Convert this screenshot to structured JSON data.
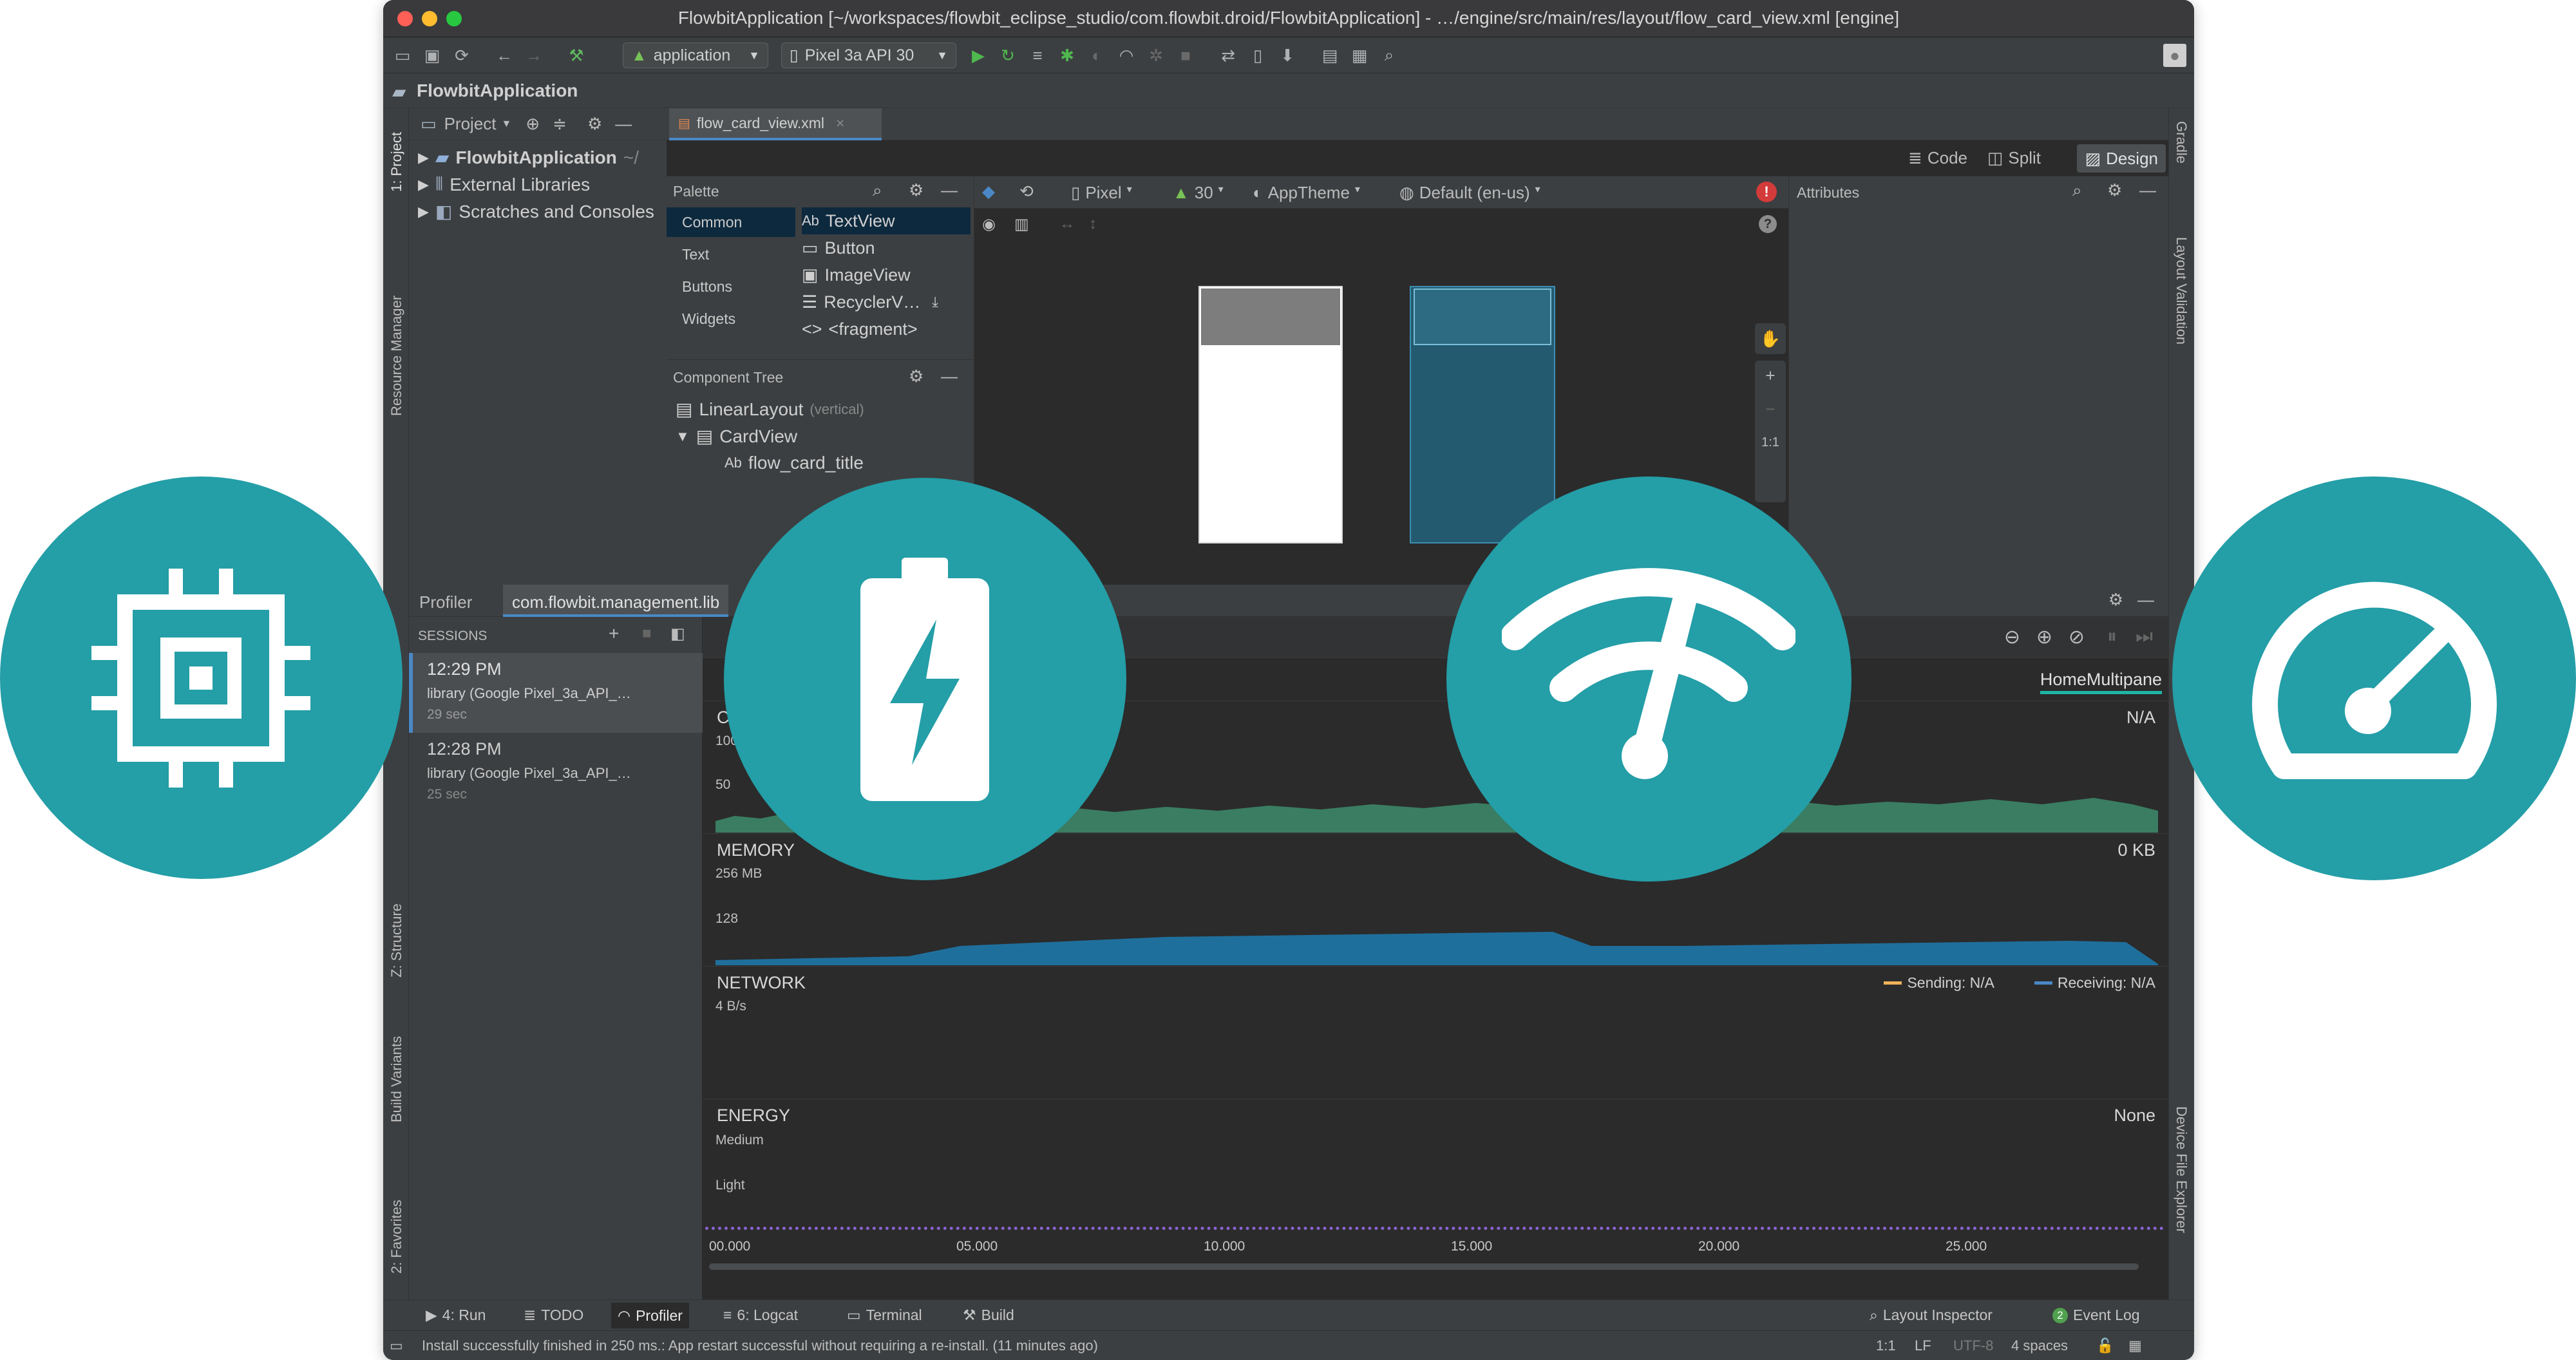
{
  "window": {
    "title": "FlowbitApplication [~/workspaces/flowbit_eclipse_studio/com.flowbit.droid/FlowbitApplication] - …/engine/src/main/res/layout/flow_card_view.xml [engine]"
  },
  "toolbar": {
    "run_config": "application",
    "device": "Pixel 3a API 30"
  },
  "navbar": {
    "project_name": "FlowbitApplication"
  },
  "left_strip": {
    "project_tab": "1: Project",
    "resource_manager": "Resource Manager",
    "structure": "Z: Structure",
    "build_variants": "Build Variants",
    "favorites": "2: Favorites"
  },
  "right_strip": {
    "gradle": "Gradle",
    "layout_validation": "Layout Validation",
    "device_file_explorer": "Device File Explorer"
  },
  "project_panel": {
    "view_label": "Project",
    "items": [
      {
        "label": "FlowbitApplication",
        "suffix": "~/"
      },
      {
        "label": "External Libraries"
      },
      {
        "label": "Scratches and Consoles"
      }
    ]
  },
  "editor": {
    "tab": "flow_card_view.xml",
    "mode_code": "Code",
    "mode_split": "Split",
    "mode_design": "Design"
  },
  "palette": {
    "title": "Palette",
    "categories": [
      "Common",
      "Text",
      "Buttons",
      "Widgets"
    ],
    "items": [
      {
        "icon": "Ab",
        "label": "TextView"
      },
      {
        "icon": "▭",
        "label": "Button"
      },
      {
        "icon": "▣",
        "label": "ImageView"
      },
      {
        "icon": "☰",
        "label": "RecyclerV…"
      },
      {
        "icon": "<>",
        "label": "<fragment>"
      }
    ]
  },
  "component_tree": {
    "title": "Component Tree",
    "rows": [
      {
        "label": "LinearLayout",
        "note": "(vertical)"
      },
      {
        "label": "CardView"
      },
      {
        "label": "flow_card_title"
      }
    ]
  },
  "design_toolbar": {
    "device": "Pixel",
    "api": "30",
    "theme": "AppTheme",
    "locale": "Default (en-us)",
    "zoom_fit": "1:1"
  },
  "attributes": {
    "title": "Attributes"
  },
  "profiler": {
    "tab_profiler": "Profiler",
    "tab_process": "com.flowbit.management.lib",
    "sessions_label": "SESSIONS",
    "sessions": [
      {
        "time": "12:29 PM",
        "name": "library (Google Pixel_3a_API_…",
        "duration": "29 sec"
      },
      {
        "time": "12:28 PM",
        "name": "library (Google Pixel_3a_API_…",
        "duration": "25 sec"
      }
    ],
    "activity_label": "HomeMultipane",
    "cpu": {
      "label": "CPU",
      "value": "N/A",
      "tick_top": "100 %",
      "tick_mid": "50"
    },
    "memory": {
      "label": "MEMORY",
      "value": "0 KB",
      "tick_top": "256 MB",
      "tick_mid": "128"
    },
    "network": {
      "label": "NETWORK",
      "tick_top": "4 B/s",
      "sending": "Sending: N/A",
      "receiving": "Receiving: N/A"
    },
    "energy": {
      "label": "ENERGY",
      "value": "None",
      "tick_top": "Medium",
      "tick_mid": "Light"
    },
    "timeline": [
      "00.000",
      "05.000",
      "10.000",
      "15.000",
      "20.000",
      "25.000"
    ]
  },
  "bottom_tabs": {
    "run": "4: Run",
    "todo": "TODO",
    "profiler": "Profiler",
    "logcat": "6: Logcat",
    "terminal": "Terminal",
    "build": "Build",
    "layout_inspector": "Layout Inspector",
    "event_log": "Event Log",
    "event_count": "2"
  },
  "status": {
    "message": "Install successfully finished in 250 ms.: App restart successful without requiring a re-install. (11 minutes ago)",
    "position": "1:1",
    "line_sep": "LF",
    "encoding": "UTF-8",
    "indent": "4 spaces"
  },
  "colors": {
    "overlay_circle": "#249ea7",
    "cpu_fill": "#3a7d62",
    "memory_fill": "#1f6f9c",
    "energy_line": "#8a63d2",
    "selection_underline": "#1fb6a7"
  },
  "overlay_icons": [
    "cpu-chip-icon",
    "battery-charging-icon",
    "network-speed-icon",
    "speedometer-icon"
  ]
}
